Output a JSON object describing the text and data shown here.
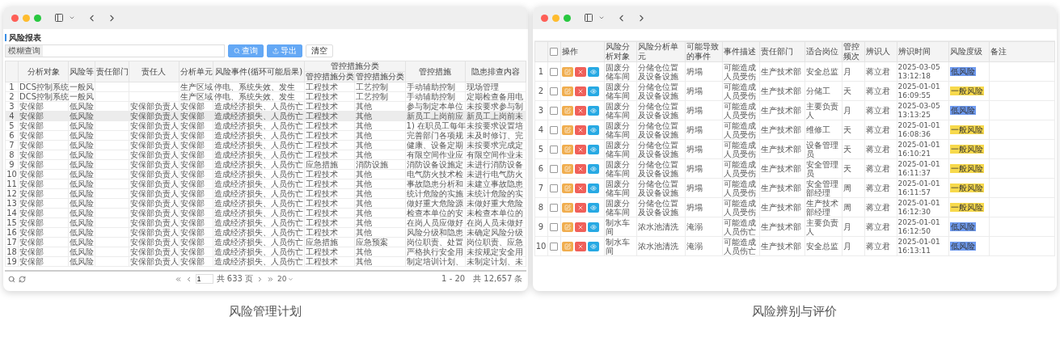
{
  "windows": [
    {
      "kind": "report",
      "caption": "风险管理计划",
      "title": "风险报表",
      "search": {
        "label": "模糊查询"
      },
      "buttons": [
        {
          "label": "查询",
          "kind": "search"
        },
        {
          "label": "导出",
          "kind": "export"
        },
        {
          "label": "清空",
          "kind": "plain"
        }
      ],
      "column_groups": [
        {
          "label": "管控措施分类"
        }
      ],
      "columns": [
        {
          "label": "分析对象",
          "in_group": false
        },
        {
          "label": "风险等",
          "in_group": false
        },
        {
          "label": "责任部门",
          "in_group": false
        },
        {
          "label": "责任人",
          "in_group": false
        },
        {
          "label": "分析单元",
          "in_group": false
        },
        {
          "label": "风险事件(循环可能后果)",
          "in_group": false
        },
        {
          "label": "管控措施分类",
          "in_group": true
        },
        {
          "label": "管控措施分类",
          "in_group": true
        },
        {
          "label": "管控措施",
          "in_group": false
        },
        {
          "label": "隐患排查内容",
          "in_group": false
        }
      ],
      "rows": [
        {
          "no": "1",
          "selected": false,
          "cells": [
            "DCS控制系统",
            "一般风",
            null,
            null,
            "生产区域",
            "停电、系统失效、发生",
            "工程技术",
            "工艺控制",
            "手动辅助控制",
            "现场管理"
          ]
        },
        {
          "no": "2",
          "selected": false,
          "cells": [
            "DCS控制系统",
            "一般风",
            null,
            null,
            "生产区域",
            "停电、系统失效、发生",
            "工程技术",
            "工艺控制",
            "手动辅助控制",
            "定期检查备用电"
          ]
        },
        {
          "no": "3",
          "selected": false,
          "cells": [
            "安保部",
            "低风险",
            null,
            "安保部负责人",
            "安保部",
            "造成经济损失、人员伤亡",
            "工程技术",
            "其他",
            "参与制定本单位",
            "未按要求参与制"
          ]
        },
        {
          "no": "4",
          "selected": true,
          "cells": [
            "安保部",
            "低风险",
            null,
            "安保部负责人",
            "安保部",
            "造成经济损失、人员伤亡",
            "工程技术",
            "其他",
            "新员工上岗前应",
            "新员工上岗前未"
          ]
        },
        {
          "no": "5",
          "selected": false,
          "cells": [
            "安保部",
            "低风险",
            null,
            "安保部负责人",
            "安保部",
            "造成经济损失、人员伤亡",
            "工程技术",
            "其他",
            "1) 在职员工每年",
            "未按要求设置培"
          ]
        },
        {
          "no": "6",
          "selected": false,
          "cells": [
            "安保部",
            "低风险",
            null,
            "安保部负责人",
            "安保部",
            "造成经济损失、人员伤亡",
            "工程技术",
            "其他",
            "完善部门各项规",
            "未及时修订、完"
          ]
        },
        {
          "no": "7",
          "selected": false,
          "cells": [
            "安保部",
            "低风险",
            null,
            "安保部负责人",
            "安保部",
            "造成经济损失、人员伤亡",
            "工程技术",
            "其他",
            "健康、设备定期",
            "未按要求完成定"
          ]
        },
        {
          "no": "8",
          "selected": false,
          "cells": [
            "安保部",
            "低风险",
            null,
            "安保部负责人",
            "安保部",
            "造成经济损失、人员伤亡",
            "工程技术",
            "其他",
            "有限空间作业应",
            "有限空间作业未"
          ]
        },
        {
          "no": "9",
          "selected": false,
          "cells": [
            "安保部",
            "低风险",
            null,
            "安保部负责人",
            "安保部",
            "造成经济损失、人员伤亡",
            "应急措施",
            "消防设施",
            "消防设备设施定",
            "未进行消防设备"
          ]
        },
        {
          "no": "10",
          "selected": false,
          "cells": [
            "安保部",
            "低风险",
            null,
            "安保部负责人",
            "安保部",
            "造成经济损失、人员伤亡",
            "工程技术",
            "其他",
            "电气防火技术检",
            "未进行电气防火"
          ]
        },
        {
          "no": "11",
          "selected": false,
          "cells": [
            "安保部",
            "低风险",
            null,
            "安保部负责人",
            "安保部",
            "造成经济损失、人员伤亡",
            "工程技术",
            "其他",
            "事故隐患分析和",
            "未建立事故隐患"
          ]
        },
        {
          "no": "12",
          "selected": false,
          "cells": [
            "安保部",
            "低风险",
            null,
            "安保部负责人",
            "安保部",
            "造成经济损失、人员伤亡",
            "工程技术",
            "其他",
            "统计危险的实施",
            "未统计危险的实"
          ]
        },
        {
          "no": "13",
          "selected": false,
          "cells": [
            "安保部",
            "低风险",
            null,
            "安保部负责人",
            "安保部",
            "造成经济损失、人员伤亡",
            "工程技术",
            "其他",
            "做好重大危险源",
            "未做好重大危险"
          ]
        },
        {
          "no": "14",
          "selected": false,
          "cells": [
            "安保部",
            "低风险",
            null,
            "安保部负责人",
            "安保部",
            "造成经济损失、人员伤亡",
            "工程技术",
            "其他",
            "检查本单位的安",
            "未检查本单位的"
          ]
        },
        {
          "no": "15",
          "selected": false,
          "cells": [
            "安保部",
            "低风险",
            null,
            "安保部负责人",
            "安保部",
            "造成经济损失、人员伤亡",
            "工程技术",
            "其他",
            "在岗人员应做好",
            "在岗人员未做好"
          ]
        },
        {
          "no": "16",
          "selected": false,
          "cells": [
            "安保部",
            "低风险",
            null,
            "安保部负责人",
            "安保部",
            "造成经济损失、人员伤亡",
            "工程技术",
            "其他",
            "风险分级和隐患",
            "未确定风险分级"
          ]
        },
        {
          "no": "17",
          "selected": false,
          "cells": [
            "安保部",
            "低风险",
            null,
            "安保部负责人",
            "安保部",
            "造成经济损失、人员伤亡",
            "应急措施",
            "应急预案",
            "岗位职责、处置",
            "岗位职责、应急"
          ]
        },
        {
          "no": "18",
          "selected": false,
          "cells": [
            "安保部",
            "低风险",
            null,
            "安保部负责人",
            "安保部",
            "造成经济损失、人员伤亡",
            "工程技术",
            "其他",
            "严格执行安全用",
            "未按规定安全用"
          ]
        },
        {
          "no": "19",
          "selected": false,
          "cells": [
            "安保部",
            "低风险",
            null,
            "安保部负责人",
            "安保部",
            "造成经济损失、人员伤亡",
            "工程技术",
            "其他",
            "制定培训计划、",
            "未制定计划、未"
          ]
        }
      ],
      "pager": {
        "page": "1",
        "pages": "共 633 页",
        "size": "20",
        "summary": "1 - 20　共 12,657 条"
      }
    },
    {
      "kind": "list",
      "caption": "风险辨别与评价",
      "all_checked": false,
      "actions_header": "操作",
      "columns": [
        "风险分析对象",
        "风险分析单元",
        "可能导致的事件",
        "事件描述",
        "责任部门",
        "适合岗位",
        "管控频次",
        "辨识人",
        "辨识时间",
        "风险度级",
        "备注"
      ],
      "rows": [
        {
          "no": "1",
          "checked": false,
          "cells": [
            "固废分储车间",
            "分储仓位置及设备设施",
            "坍塌",
            "可能造成人员受伤",
            "生产技术部",
            "安全总监",
            "月",
            "蒋立君",
            "2025-03-05 13:12:18"
          ],
          "risk": {
            "label": "低风险",
            "color": "#6f9bf0"
          }
        },
        {
          "no": "2",
          "checked": false,
          "cells": [
            "固废分储车间",
            "分储仓位置及设备设施",
            "坍塌",
            "可能造成人员受伤",
            "生产技术部",
            "分储工",
            "天",
            "蒋立君",
            "2025-01-01 16:09:55"
          ],
          "risk": {
            "label": "一般风险",
            "color": "#f7d94c"
          }
        },
        {
          "no": "3",
          "checked": false,
          "cells": [
            "固废分储车间",
            "分储仓位置及设备设施",
            "坍塌",
            "可能造成人员受伤",
            "生产技术部",
            "主要负责人",
            "月",
            "蒋立君",
            "2025-03-05 13:13:25"
          ],
          "risk": {
            "label": "低风险",
            "color": "#6f9bf0"
          }
        },
        {
          "no": "4",
          "checked": false,
          "cells": [
            "固废分储车间",
            "分储仓位置及设备设施",
            "坍塌",
            "可能造成人员受伤",
            "生产技术部",
            "维修工",
            "天",
            "蒋立君",
            "2025-01-01 16:08:36"
          ],
          "risk": {
            "label": "一般风险",
            "color": "#f7d94c"
          }
        },
        {
          "no": "5",
          "checked": false,
          "cells": [
            "固废分储车间",
            "分储仓位置及设备设施",
            "坍塌",
            "可能造成人员受伤",
            "生产技术部",
            "设备管理员",
            "天",
            "蒋立君",
            "2025-01-01 16:10:21"
          ],
          "risk": {
            "label": "一般风险",
            "color": "#f7d94c"
          }
        },
        {
          "no": "6",
          "checked": false,
          "cells": [
            "固废分储车间",
            "分储仓位置及设备设施",
            "坍塌",
            "可能造成人员受伤",
            "生产技术部",
            "安全管理员",
            "天",
            "蒋立君",
            "2025-01-01 16:11:37"
          ],
          "risk": {
            "label": "一般风险",
            "color": "#f7d94c"
          }
        },
        {
          "no": "7",
          "checked": false,
          "cells": [
            "固废分储车间",
            "分储仓位置及设备设施",
            "坍塌",
            "可能造成人员受伤",
            "生产技术部",
            "安全管理部经理",
            "周",
            "蒋立君",
            "2025-01-01 16:11:57"
          ],
          "risk": {
            "label": "一般风险",
            "color": "#f7d94c"
          }
        },
        {
          "no": "8",
          "checked": false,
          "cells": [
            "固废分储车间",
            "分储仓位置及设备设施",
            "坍塌",
            "可能造成人员受伤",
            "生产技术部",
            "生产技术部经理",
            "周",
            "蒋立君",
            "2025-01-01 16:12:30"
          ],
          "risk": {
            "label": "一般风险",
            "color": "#f7d94c"
          }
        },
        {
          "no": "9",
          "checked": false,
          "cells": [
            "制水车间",
            "浓水池清洗",
            "淹溺",
            "可能造成人员伤亡",
            "生产技术部",
            "主要负责人",
            "月",
            "蒋立君",
            "2025-01-01 16:12:50"
          ],
          "risk": {
            "label": "低风险",
            "color": "#6f9bf0"
          }
        },
        {
          "no": "10",
          "checked": false,
          "cells": [
            "制水车间",
            "浓水池清洗",
            "淹溺",
            "可能造成人员伤亡",
            "生产技术部",
            "安全总监",
            "月",
            "蒋立君",
            "2025-01-01 16:13:11"
          ],
          "risk": {
            "label": "低风险",
            "color": "#6f9bf0"
          }
        }
      ]
    }
  ]
}
